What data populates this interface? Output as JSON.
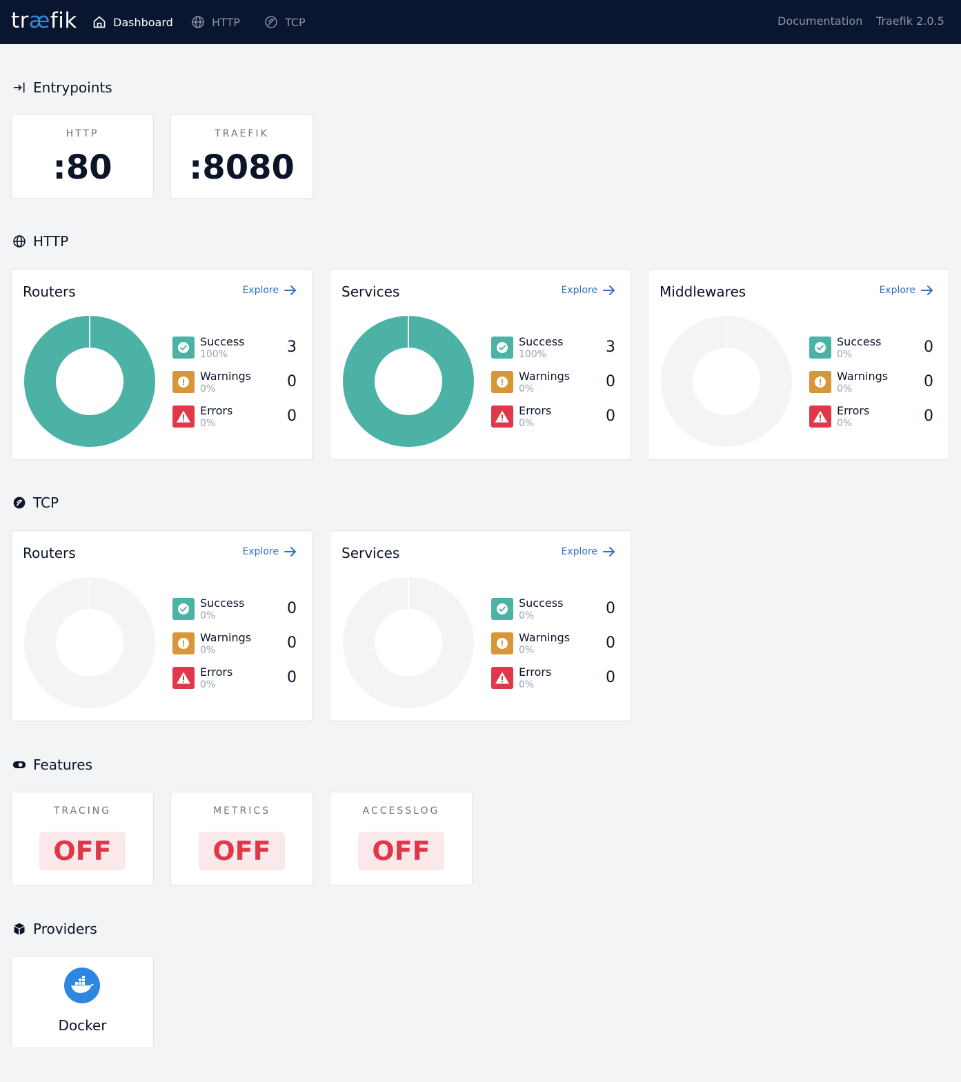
{
  "nav": {
    "logo_pre": "tr",
    "logo_ae": "æ",
    "logo_post": "fik",
    "links": [
      {
        "label": "Dashboard",
        "icon": "home-icon"
      },
      {
        "label": "HTTP",
        "icon": "globe-icon"
      },
      {
        "label": "TCP",
        "icon": "tcp-icon"
      }
    ],
    "documentation": "Documentation",
    "version": "Traefik 2.0.5"
  },
  "colors": {
    "nav_bg": "#0a1530",
    "success": "#4db2a6",
    "warning": "#d9953a",
    "error": "#e0384a",
    "accent": "#2f6fc7",
    "empty_donut": "#f3f4f6"
  },
  "entrypoints": {
    "title": "Entrypoints",
    "items": [
      {
        "label": "HTTP",
        "value": ":80"
      },
      {
        "label": "TRAEFIK",
        "value": ":8080"
      }
    ]
  },
  "http": {
    "title": "HTTP",
    "cards": [
      {
        "title": "Routers",
        "explore": "Explore",
        "stats": [
          {
            "label": "Success",
            "pct": "100%",
            "count": "3"
          },
          {
            "label": "Warnings",
            "pct": "0%",
            "count": "0"
          },
          {
            "label": "Errors",
            "pct": "0%",
            "count": "0"
          }
        ]
      },
      {
        "title": "Services",
        "explore": "Explore",
        "stats": [
          {
            "label": "Success",
            "pct": "100%",
            "count": "3"
          },
          {
            "label": "Warnings",
            "pct": "0%",
            "count": "0"
          },
          {
            "label": "Errors",
            "pct": "0%",
            "count": "0"
          }
        ]
      },
      {
        "title": "Middlewares",
        "explore": "Explore",
        "stats": [
          {
            "label": "Success",
            "pct": "0%",
            "count": "0"
          },
          {
            "label": "Warnings",
            "pct": "0%",
            "count": "0"
          },
          {
            "label": "Errors",
            "pct": "0%",
            "count": "0"
          }
        ]
      }
    ]
  },
  "tcp": {
    "title": "TCP",
    "cards": [
      {
        "title": "Routers",
        "explore": "Explore",
        "stats": [
          {
            "label": "Success",
            "pct": "0%",
            "count": "0"
          },
          {
            "label": "Warnings",
            "pct": "0%",
            "count": "0"
          },
          {
            "label": "Errors",
            "pct": "0%",
            "count": "0"
          }
        ]
      },
      {
        "title": "Services",
        "explore": "Explore",
        "stats": [
          {
            "label": "Success",
            "pct": "0%",
            "count": "0"
          },
          {
            "label": "Warnings",
            "pct": "0%",
            "count": "0"
          },
          {
            "label": "Errors",
            "pct": "0%",
            "count": "0"
          }
        ]
      }
    ]
  },
  "features": {
    "title": "Features",
    "items": [
      {
        "label": "TRACING",
        "value": "OFF"
      },
      {
        "label": "METRICS",
        "value": "OFF"
      },
      {
        "label": "ACCESSLOG",
        "value": "OFF"
      }
    ]
  },
  "providers": {
    "title": "Providers",
    "items": [
      {
        "name": "Docker",
        "icon": "docker-icon"
      }
    ]
  }
}
